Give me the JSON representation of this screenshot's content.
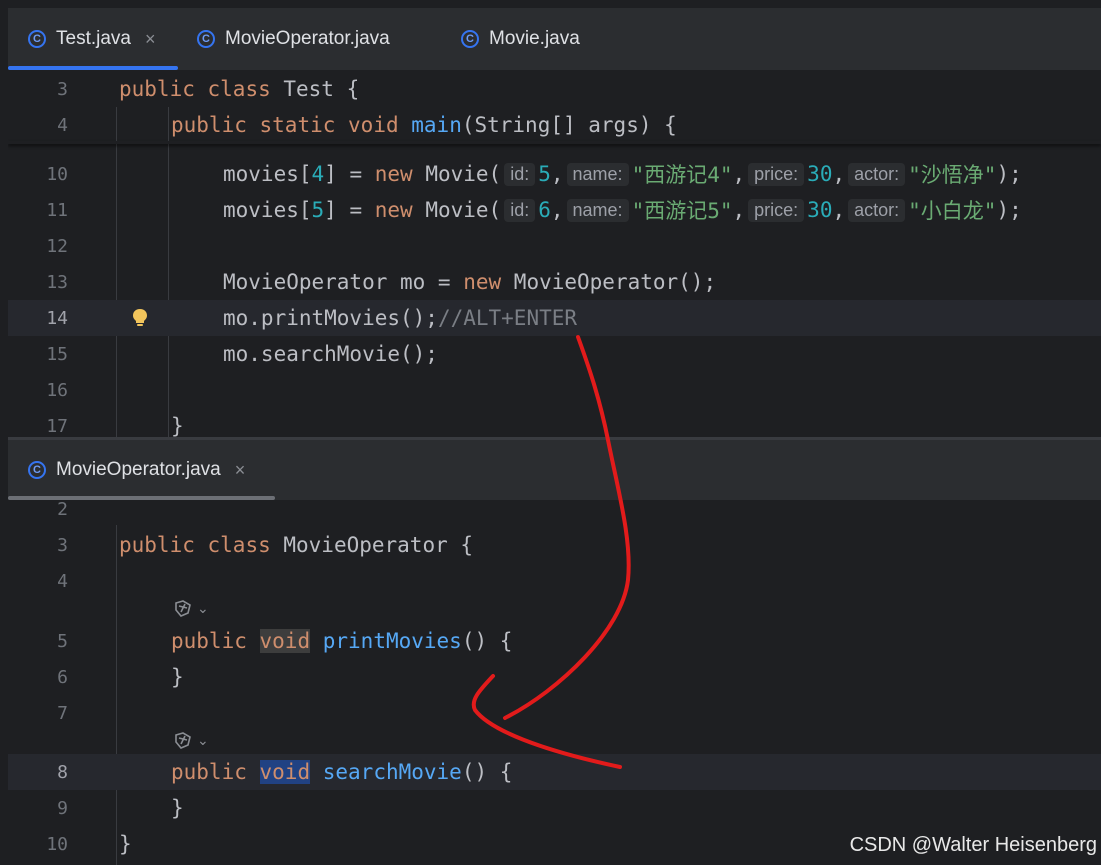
{
  "top_tabs": [
    {
      "label": "Test.java",
      "active": true,
      "has_close": true
    },
    {
      "label": "MovieOperator.java",
      "active": false,
      "has_close": false
    },
    {
      "label": "Movie.java",
      "active": false,
      "has_close": false
    }
  ],
  "bottom_tab": {
    "label": "MovieOperator.java"
  },
  "top_editor": {
    "ln3": "3",
    "ln4": "4",
    "ln10": "10",
    "ln11": "11",
    "ln12": "12",
    "ln13": "13",
    "ln14": "14",
    "ln15": "15",
    "ln16": "16",
    "ln17": "17",
    "l3": {
      "kw1": "public",
      "kw2": "class",
      "rest": " Test {"
    },
    "l4": {
      "kw1": "public",
      "kw2": "static",
      "kw3": "void",
      "fn": "main",
      "rest": "(String[] args) {"
    },
    "l10": {
      "a": "movies[",
      "idx": "4",
      "b": "] = ",
      "new": "new",
      "c": " Movie(",
      "h_id": "id:",
      "v_id": "5",
      "h_name": "name:",
      "v_name": "\"西游记4\"",
      "h_price": "price:",
      "v_price": "30",
      "h_actor": "actor:",
      "v_actor": "\"沙悟净\"",
      "end": ");"
    },
    "l11": {
      "a": "movies[",
      "idx": "5",
      "b": "] = ",
      "new": "new",
      "c": " Movie(",
      "h_id": "id:",
      "v_id": "6",
      "h_name": "name:",
      "v_name": "\"西游记5\"",
      "h_price": "price:",
      "v_price": "30",
      "h_actor": "actor:",
      "v_actor": "\"小白龙\"",
      "end": ");"
    },
    "l13": {
      "a": "MovieOperator mo = ",
      "new": "new",
      "b": " MovieOperator();"
    },
    "l14": {
      "code": "mo.printMovies();",
      "comment": "//ALT+ENTER"
    },
    "l15": {
      "code": "mo.searchMovie();"
    },
    "l17": {
      "code": "}"
    }
  },
  "bottom_editor": {
    "ln2": "2",
    "ln3": "3",
    "ln4": "4",
    "ln5": "5",
    "ln6": "6",
    "ln7": "7",
    "ln8": "8",
    "ln9": "9",
    "ln10": "10",
    "l3": {
      "kw1": "public",
      "kw2": "class",
      "rest": " MovieOperator {"
    },
    "l5": {
      "kw1": "public",
      "kw2": "void",
      "fn": "printMovies",
      "rest": "() {"
    },
    "l6": {
      "code": "}"
    },
    "l8": {
      "kw1": "public",
      "kw2": "void",
      "fn": "searchMovie",
      "rest": "() {"
    },
    "l9": {
      "code": "}"
    },
    "l10": {
      "code": "}"
    }
  },
  "icons": {
    "lightbulb": "lightbulb-icon",
    "ai": "ai-assistant-icon",
    "class": "class-icon",
    "close": "close-icon"
  },
  "watermark": "CSDN @Walter Heisenberg"
}
